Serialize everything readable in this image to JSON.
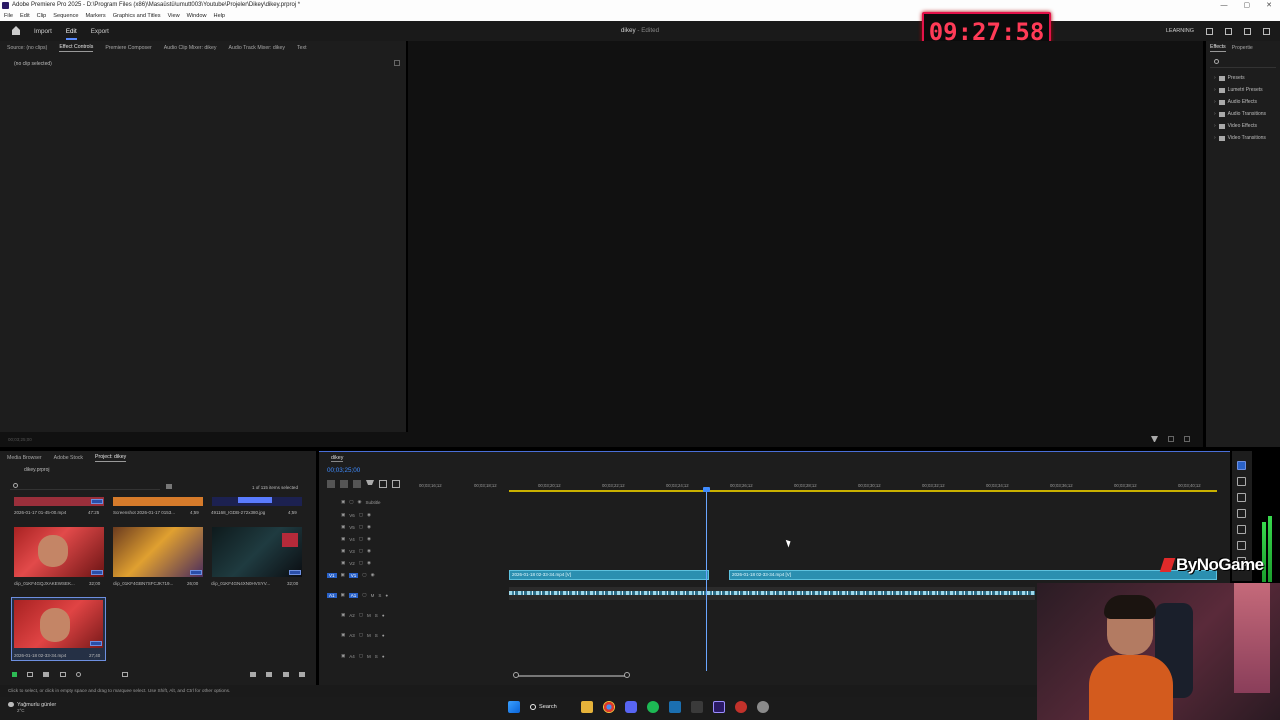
{
  "window": {
    "title": "Adobe Premiere Pro 2025 - D:\\Program Files (x86)\\Masaüstü\\umutt003\\Youtube\\Projeler\\Dikey\\dikey.prproj *",
    "controls": [
      "—",
      "▢",
      "✕"
    ]
  },
  "menu": [
    "File",
    "Edit",
    "Clip",
    "Sequence",
    "Markers",
    "Graphics and Titles",
    "View",
    "Window",
    "Help"
  ],
  "header": {
    "nav": [
      "Import",
      "Edit",
      "Export"
    ],
    "doc_title": "dikey",
    "doc_state": " - Edited",
    "right_label": "LEARNING"
  },
  "timer": {
    "value": "09:27:58"
  },
  "effect_controls": {
    "tabs": [
      "Source: (no clips)",
      "Effect Controls",
      "Premiere Composer",
      "Audio Clip Mixer: dikey",
      "Audio Track Mixer: dikey",
      "Text"
    ],
    "active_tab": "Effect Controls",
    "empty_text": "(no clip selected)",
    "bottom_time": "00;03;25;00"
  },
  "effects_panel": {
    "tabs": [
      "Effects",
      "Propertie"
    ],
    "items": [
      "Presets",
      "Lumetri Presets",
      "Audio Effects",
      "Audio Transitions",
      "Video Effects",
      "Video Transitions"
    ]
  },
  "project_panel": {
    "tabs": [
      "Media Browser",
      "Adobe Stock",
      "Project: dikey"
    ],
    "file": "dikey.prproj",
    "selection_info": "1 of 115 items selected",
    "top_row": [
      {
        "name": "2026-01-17 01-45-00.mp4",
        "dur": "47:25"
      },
      {
        "name": "Screenshot 2026-01-17 0153...",
        "dur": "4;59"
      },
      {
        "name": "491168_IGDB-272x380.jpg",
        "dur": "4;59"
      }
    ],
    "mid_row": [
      {
        "name": "clip_01KF4GQJXAKEWSEK...",
        "dur": "32;00"
      },
      {
        "name": "clip_01KF4GBN7SFCJK719...",
        "dur": "26;00"
      },
      {
        "name": "clip_01KF4GN4XN0HVSYV...",
        "dur": "32;00"
      }
    ],
    "selected": {
      "name": "2026-01-18 02-33-34.mp4",
      "dur": "27;40"
    }
  },
  "timeline": {
    "sequence": "dikey",
    "timecode": "00;03;25;00",
    "ruler": [
      "00;03;16;12",
      "00;03;18;12",
      "00;03;20;12",
      "00;03;22;12",
      "00;03;24;12",
      "00;03;26;12",
      "00;03;28;12",
      "00;03;30;12",
      "00;03;32;12",
      "00;03;34;12",
      "00;03;36;12",
      "00;03;38;12",
      "00;03;40;12"
    ],
    "subtitle_track": "Subtitle",
    "video_tracks": [
      "V6",
      "V5",
      "V4",
      "V3",
      "V2",
      "V1"
    ],
    "audio_tracks": [
      "A1",
      "A2",
      "A3",
      "A4"
    ],
    "audio_controls": [
      "M",
      "S"
    ],
    "clips": [
      {
        "label": "2026-01-18 02-33-34.mp4 [V]"
      },
      {
        "label": "2026-01-18 02-33-34.mp4 [V]"
      }
    ]
  },
  "status_bar": {
    "text": "Click to select, or click in empty space and drag to marquee select. Use Shift, Alt, and Ctrl for other options."
  },
  "taskbar": {
    "weather": "Yağmurlu günler",
    "weather_temp": "2°C",
    "search": "Search"
  },
  "overlay": {
    "watermark": "ByNoGame"
  }
}
